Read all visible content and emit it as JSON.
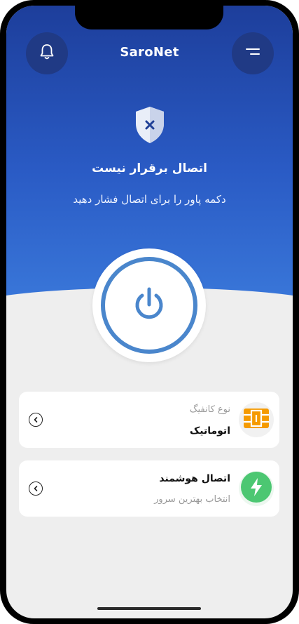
{
  "app": {
    "title": "SaroNet"
  },
  "status": {
    "title": "اتصال برقرار نیست",
    "subtitle": "دکمه پاور را برای اتصال فشار دهید"
  },
  "icons": {
    "bell": "bell-icon",
    "menu": "menu-icon",
    "shield": "shield-x-icon",
    "power": "power-icon",
    "config": "sim-chip-icon",
    "smart": "lightning-icon",
    "chevron": "chevron-left-icon"
  },
  "config_card": {
    "label": "نوع کانفیگ",
    "value": "اتوماتیک"
  },
  "smart_card": {
    "title": "اتصال هوشمند",
    "subtitle": "انتخاب بهترین سرور"
  },
  "colors": {
    "header_top": "#1d3e9b",
    "header_bottom": "#3a78da",
    "power_ring": "#4a86cc",
    "config_icon": "#f59a00",
    "smart_icon": "#4cc772"
  }
}
